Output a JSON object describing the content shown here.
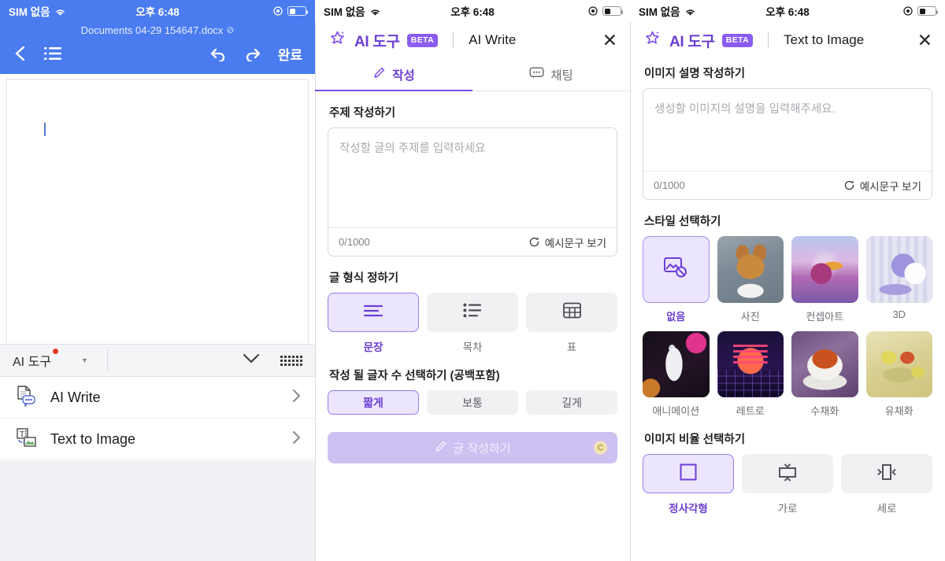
{
  "status_bar": {
    "carrier": "SIM 없음",
    "time": "오후 6:48"
  },
  "doc_panel": {
    "file_name": "Documents 04-29 154647.docx",
    "saved_mark": "⊘",
    "done_label": "완료",
    "toolbar": {
      "ai_tool_label": "AI 도구"
    },
    "menu_items": [
      {
        "label": "AI Write",
        "icon": "ai-write-icon"
      },
      {
        "label": "Text to Image",
        "icon": "text-to-image-icon"
      }
    ]
  },
  "ai_write_panel": {
    "brand": "AI 도구",
    "badge": "BETA",
    "feature_title": "AI Write",
    "tabs": [
      {
        "label": "작성",
        "icon": "pen-icon",
        "active": true
      },
      {
        "label": "채팅",
        "icon": "chat-icon",
        "active": false
      }
    ],
    "topic": {
      "section_title": "주제 작성하기",
      "placeholder": "작성할 글의 주제를 입력하세요",
      "value": "",
      "counter": "0/1000",
      "sample_label": "예시문구 보기"
    },
    "format": {
      "section_title": "글 형식 정하기",
      "options": [
        {
          "label": "문장",
          "icon": "paragraph-icon",
          "selected": true
        },
        {
          "label": "목차",
          "icon": "list-icon",
          "selected": false
        },
        {
          "label": "표",
          "icon": "table-icon",
          "selected": false
        }
      ]
    },
    "length": {
      "section_title": "작성 될 글자 수 선택하기 (공백포함)",
      "options": [
        {
          "label": "짧게",
          "selected": true
        },
        {
          "label": "보통",
          "selected": false
        },
        {
          "label": "길게",
          "selected": false
        }
      ]
    },
    "cta": {
      "label": "글 작성하기",
      "icon": "pen-icon",
      "coin": "C",
      "disabled": true
    }
  },
  "text_to_image_panel": {
    "brand": "AI 도구",
    "badge": "BETA",
    "feature_title": "Text to Image",
    "prompt": {
      "section_title": "이미지 설명 작성하기",
      "placeholder": "생성할 이미지의 설명을 입력해주세요.",
      "value": "",
      "counter": "0/1000",
      "sample_label": "예시문구 보기"
    },
    "style": {
      "section_title": "스타일 선택하기",
      "options": [
        {
          "label": "없음",
          "thumb": "none",
          "selected": true
        },
        {
          "label": "사진",
          "thumb": "photo",
          "selected": false
        },
        {
          "label": "컨셉아트",
          "thumb": "concept",
          "selected": false
        },
        {
          "label": "3D",
          "thumb": "3d",
          "selected": false
        },
        {
          "label": "애니메이션",
          "thumb": "anim",
          "selected": false
        },
        {
          "label": "레트로",
          "thumb": "retro",
          "selected": false
        },
        {
          "label": "수채화",
          "thumb": "water",
          "selected": false
        },
        {
          "label": "유채화",
          "thumb": "oil",
          "selected": false
        }
      ]
    },
    "ratio": {
      "section_title": "이미지 비율 선택하기",
      "options": [
        {
          "label": "정사각형",
          "icon": "square-icon",
          "selected": true
        },
        {
          "label": "가로",
          "icon": "landscape-icon",
          "selected": false
        },
        {
          "label": "세로",
          "icon": "portrait-icon",
          "selected": false
        }
      ]
    }
  },
  "colors": {
    "doc_blue": "#4a7cf0",
    "accent_purple": "#6b3fd4",
    "badge_purple": "#8a5cf0",
    "selected_bg": "#ece5ff",
    "notification_red": "#e8342a"
  }
}
